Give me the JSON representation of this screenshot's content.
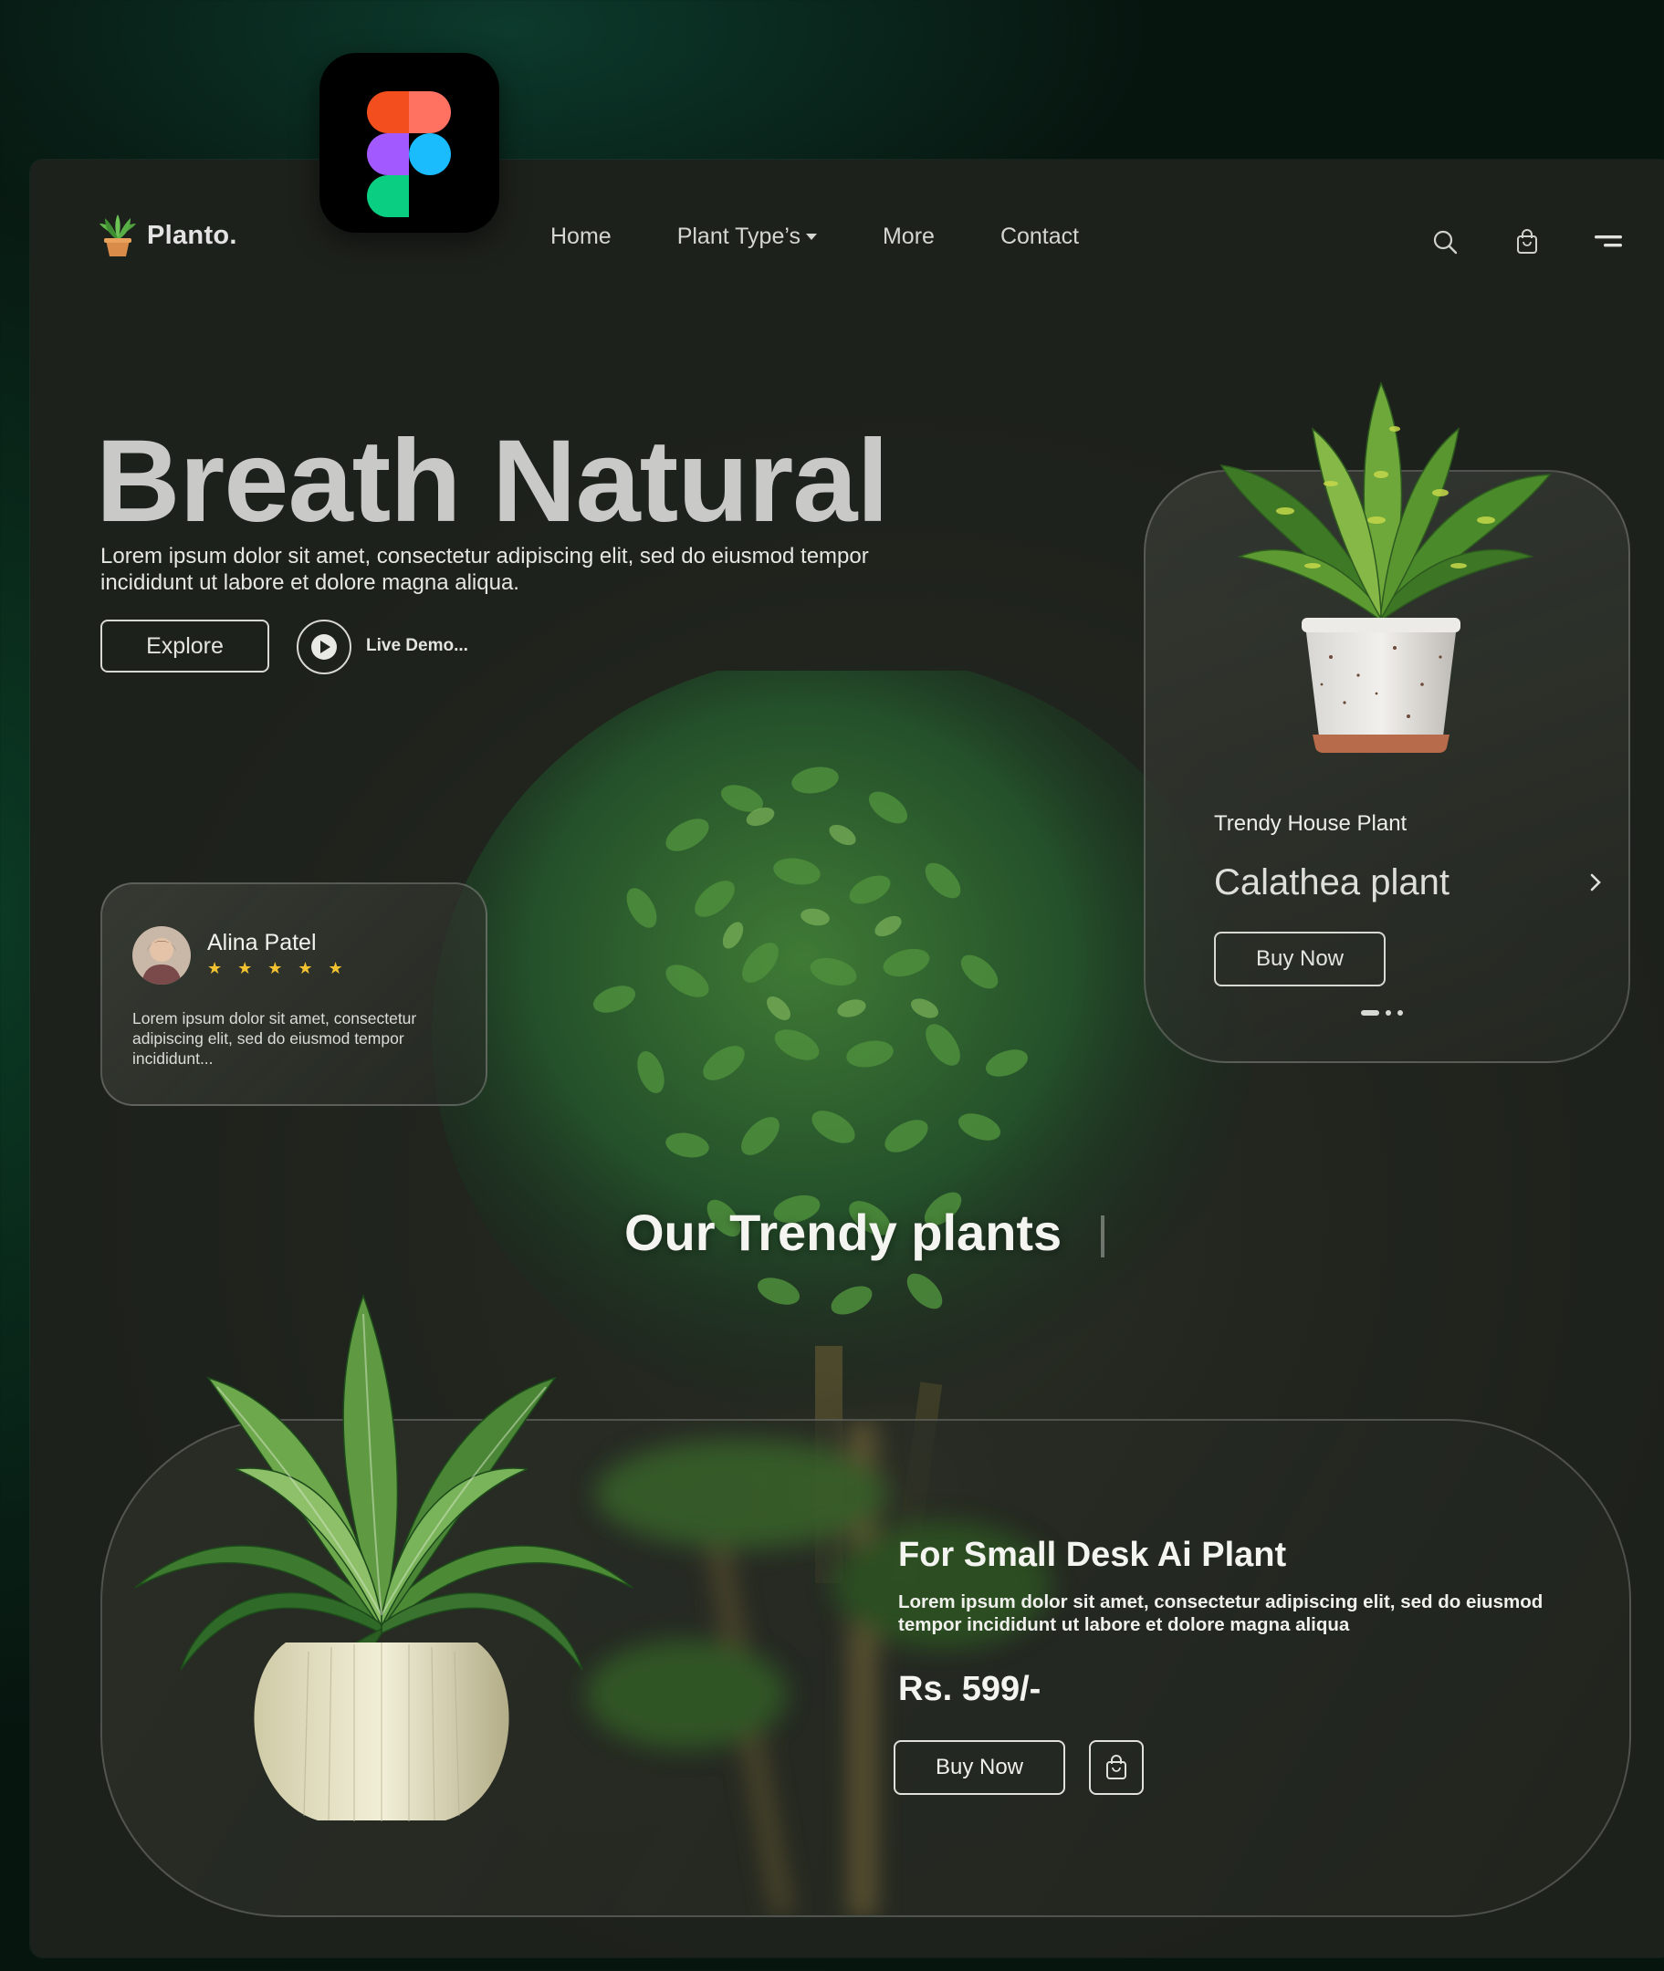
{
  "brand": {
    "name": "Planto.",
    "accent": "#5fb84a"
  },
  "nav": {
    "items": [
      {
        "label": "Home"
      },
      {
        "label": "Plant Type’s"
      },
      {
        "label": "More"
      },
      {
        "label": "Contact"
      }
    ],
    "icons": [
      "search-icon",
      "shopping-bag-icon",
      "menu-icon"
    ]
  },
  "hero": {
    "title": "Breath Natural",
    "subtitle": "Lorem ipsum dolor sit amet, consectetur adipiscing elit, sed do eiusmod tempor incididunt ut labore et dolore magna aliqua.",
    "explore_label": "Explore",
    "live_demo_label": "Live Demo..."
  },
  "review": {
    "name": "Alina Patel",
    "stars": "★ ★ ★ ★ ★",
    "rating": 4.5,
    "text": "Lorem ipsum dolor sit amet, consectetur adipiscing elit, sed do eiusmod tempor incididunt..."
  },
  "featured": {
    "tag": "Trendy House Plant",
    "title": "Calathea plant",
    "buy_label": "Buy Now",
    "slides": 3,
    "active_slide": 1
  },
  "section": {
    "title": "Our Trendy plants"
  },
  "desk_product": {
    "title": "For Small Desk Ai Plant",
    "description": "Lorem ipsum dolor sit amet, consectetur adipiscing elit, sed do eiusmod tempor incididunt ut labore et dolore magna aliqua",
    "price": "Rs. 599/-",
    "buy_label": "Buy Now"
  },
  "colors": {
    "star": "#f2c230",
    "figma_red": "#f24e1e",
    "figma_orange": "#ff7262",
    "figma_purple": "#a259ff",
    "figma_blue": "#1abcfe",
    "figma_green": "#0acf83"
  }
}
